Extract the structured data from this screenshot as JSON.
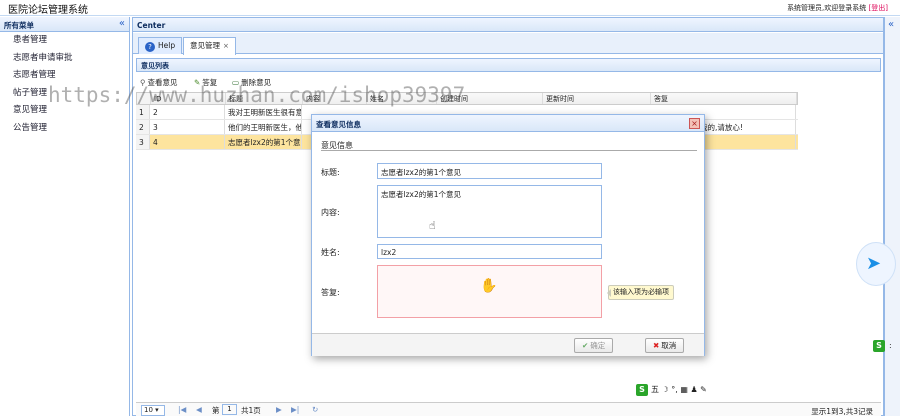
{
  "app": {
    "title": "医院论坛管理系统",
    "user_info": "系统管理员,欢迎登录系统",
    "logout": "[登出]"
  },
  "sidebar": {
    "title": "所有菜单",
    "collapse": "«",
    "items": [
      {
        "label": "患者管理"
      },
      {
        "label": "志愿者申请审批"
      },
      {
        "label": "志愿者管理"
      },
      {
        "label": "帖子管理"
      },
      {
        "label": "意见管理"
      },
      {
        "label": "公告管理"
      }
    ]
  },
  "main": {
    "title": "Center",
    "tabs": [
      {
        "label": "Help"
      },
      {
        "label": "意见管理",
        "close": "×"
      }
    ],
    "list_title": "意见列表",
    "toolbar": {
      "view": "查看意见",
      "reply": "答复",
      "delete": "删除意见"
    },
    "grid": {
      "columns": [
        "ID",
        "标题",
        "内容",
        "姓名",
        "创建时间",
        "更新时间",
        "答复"
      ],
      "rows": [
        {
          "num": "1",
          "id": "2",
          "title": "我对王明新医生很有意见",
          "content": "",
          "name": "",
          "created": "",
          "updated": "",
          "reply": ""
        },
        {
          "num": "2",
          "id": "3",
          "title": "他们的王明新医生，他",
          "content": "",
          "name": "",
          "created": "",
          "updated": "",
          "reply": "我的,请放心!"
        },
        {
          "num": "3",
          "id": "4",
          "title": "志愿者lzx2的第1个意见",
          "content": "",
          "name": "",
          "created": "",
          "updated": "",
          "reply": ""
        }
      ]
    },
    "pager": {
      "page_size": "10 ▾",
      "page_label": "第",
      "page_value": "1",
      "page_total": "共1页",
      "info": "显示1到3,共3记录"
    }
  },
  "dialog": {
    "title": "查看意见信息",
    "close": "×",
    "section": "意见信息",
    "fields": {
      "title_label": "标题:",
      "title_value": "志愿者lzx2的第1个意见",
      "content_label": "内容:",
      "content_value": "志愿者lzx2的第1个意见",
      "name_label": "姓名:",
      "name_value": "lzx2",
      "reply_label": "答复:",
      "reply_value": ""
    },
    "tooltip": "该输入项为必输项",
    "ok": "确定",
    "cancel": "取消"
  },
  "ime": {
    "label": "五 ☽ °, ▦ ♟ ✎"
  },
  "side_dots": ":",
  "watermark": "https://www.huzhan.com/ishop39397",
  "icons": {
    "help": "help-icon",
    "search": "search-icon",
    "edit": "pencil-icon",
    "delete": "delete-icon",
    "refresh": "refresh-icon",
    "bird": "bird-icon"
  },
  "colors": {
    "border": "#95b8e7",
    "selected_row": "#fde49e",
    "header_bg": "#d9e7f8"
  }
}
